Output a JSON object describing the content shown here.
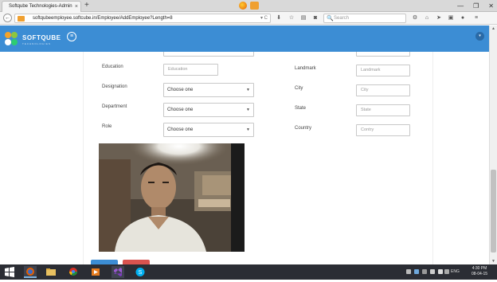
{
  "browser": {
    "tab_title": "Softqube Technologies-Admin",
    "tab_close": "×",
    "new_tab": "+",
    "window_controls": [
      "—",
      "❐",
      "✕"
    ],
    "back_arrow": "←",
    "url": "softqubeemployee.softcube.in/Employee/AddEmployee?Length=8",
    "url_right": "▾ C",
    "search_placeholder": "Search",
    "search_glyph": "🔍"
  },
  "app": {
    "logo_text": "SOFTQUBE",
    "logo_subtext": "TECHNOLOGIES",
    "menu_glyph": "≡",
    "user_glyph": "▾",
    "brand_color": "#3c8dd4"
  },
  "form": {
    "left": [
      {
        "label": "Education",
        "type": "input",
        "placeholder": "Education"
      },
      {
        "label": "Designation",
        "type": "select",
        "value": "Choose one"
      },
      {
        "label": "Department",
        "type": "select",
        "value": "Choose one"
      },
      {
        "label": "Role",
        "type": "select",
        "value": "Choose one"
      }
    ],
    "right": [
      {
        "label": "Landmark",
        "placeholder": "Landmark"
      },
      {
        "label": "City",
        "placeholder": "City"
      },
      {
        "label": "State",
        "placeholder": "State"
      },
      {
        "label": "Country",
        "placeholder": "Contry"
      }
    ],
    "caret": "▼"
  },
  "taskbar": {
    "lang": "ENG",
    "time": "4:30 PM",
    "date": "08-04-15"
  }
}
